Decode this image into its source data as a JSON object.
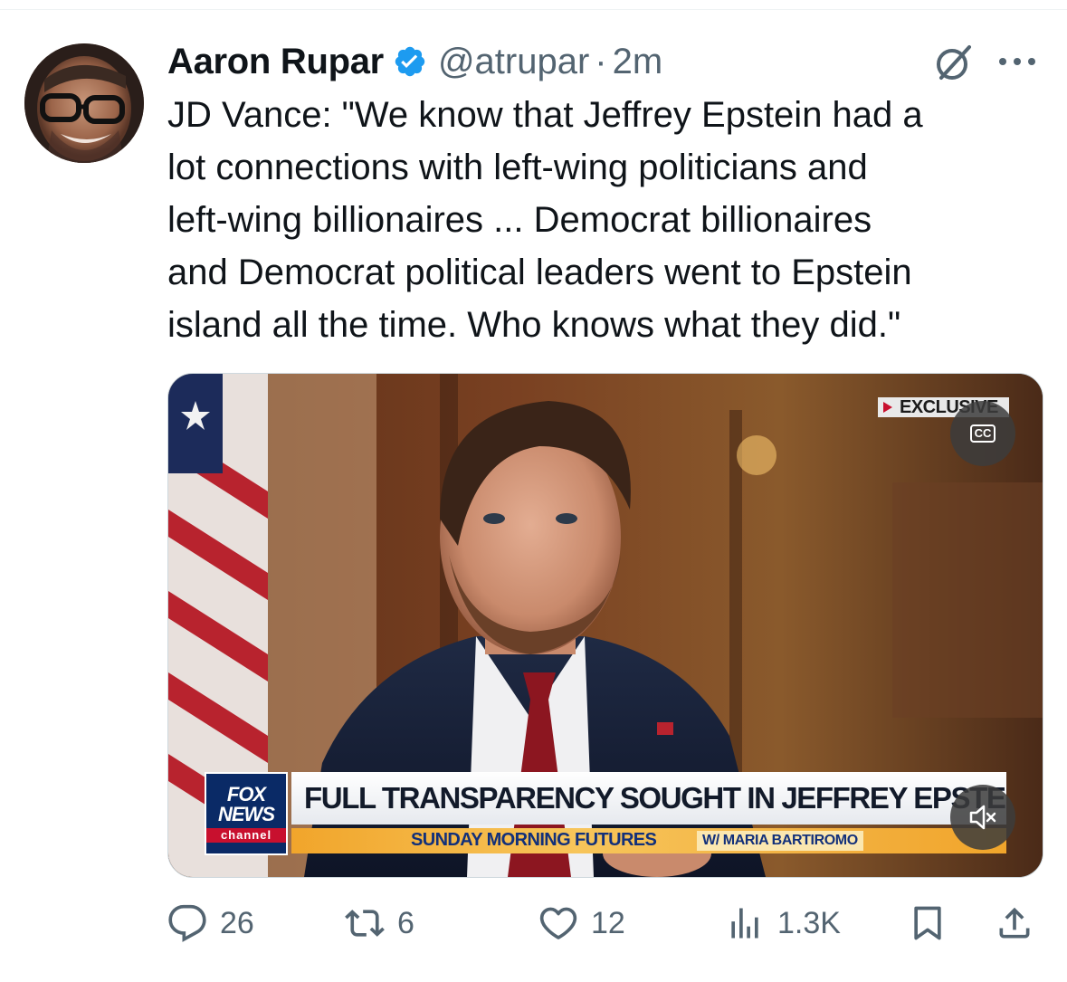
{
  "author": {
    "name": "Aaron Rupar",
    "handle": "@atrupar",
    "separator": "·",
    "time": "2m",
    "verified": true,
    "verified_color": "#1d9bf0"
  },
  "icons": {
    "grok": "grok-slash-circle-icon",
    "more": "more-dots-icon"
  },
  "tweet": {
    "text": "JD Vance: \"We know that Jeffrey Epstein had a\nlot connections with left-wing politicians and\nleft-wing billionaires ... Democrat billionaires\nand Democrat political leaders went to Epstein\nisland all the time. Who knows what they did.\""
  },
  "media": {
    "badge": "EXCLUSIVE",
    "cc_label": "CC",
    "logo_top": "FOX",
    "logo_middle": "NEWS",
    "logo_bottom": "channel",
    "headline": "FULL TRANSPARENCY SOUGHT IN JEFFREY EPSTEIN CASE",
    "show": "SUNDAY MORNING FUTURES",
    "host": "W/ MARIA BARTIROMO"
  },
  "actions": {
    "replies": "26",
    "reposts": "6",
    "likes": "12",
    "views": "1.3K"
  },
  "colors": {
    "text": "#0f1419",
    "secondary": "#536471",
    "accent": "#1d9bf0",
    "fox_red": "#c8102e",
    "fox_blue": "#0a2a66"
  }
}
